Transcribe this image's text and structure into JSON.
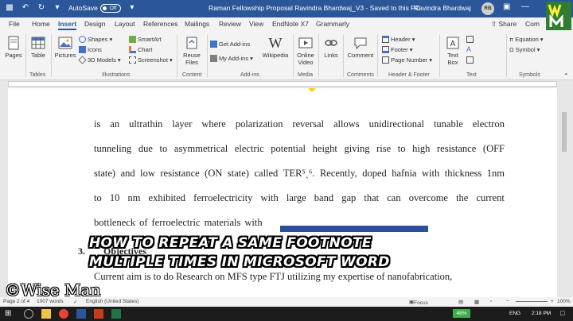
{
  "titlebar": {
    "autosave_label": "AutoSave",
    "autosave_state": "Off",
    "document_title": "Raman Fellowship Proposal Ravindra Bhardwaj_V3  -  Saved to this PC",
    "user_name": "Ravindra Bhardwaj",
    "user_initials": "RB"
  },
  "tabs": [
    "File",
    "Home",
    "Insert",
    "Design",
    "Layout",
    "References",
    "Mailings",
    "Review",
    "View",
    "EndNote X7",
    "Grammarly"
  ],
  "active_tab": "Insert",
  "share_label": "Share",
  "comments_label": "Com",
  "ribbon": {
    "pages": "Pages",
    "table": "Table",
    "pictures": "Pictures",
    "shapes": "Shapes",
    "icons": "Icons",
    "models": "3D Models",
    "smartart": "SmartArt",
    "chart": "Chart",
    "screenshot": "Screenshot",
    "reuse_files": "Reuse Files",
    "get_addins": "Get Add-ins",
    "my_addins": "My Add-ins",
    "wikipedia": "Wikipedia",
    "online_video": "Online Video",
    "links": "Links",
    "comment": "Comment",
    "header": "Header",
    "footer": "Footer",
    "page_number": "Page Number",
    "text_box": "Text Box",
    "equation": "Equation",
    "symbol": "Symbol",
    "groups": {
      "tables": "Tables",
      "illustrations": "Illustrations",
      "content": "Content",
      "addins": "Add-ins",
      "media": "Media",
      "comments": "Comments",
      "header_footer": "Header & Footer",
      "text": "Text",
      "symbols": "Symbols"
    }
  },
  "document": {
    "lines": [
      [
        "is",
        "an",
        "ultrathin",
        "layer",
        "where",
        "polarization",
        "reversal",
        "allows",
        "unidirectional",
        "tunable",
        "electron"
      ],
      [
        "tunneling",
        "due",
        "to",
        "asymmetrical",
        "electric",
        "potential",
        "height",
        "giving",
        "rise",
        "to",
        "high",
        "resistance",
        "(OFF"
      ],
      [
        "state)",
        "and",
        "low",
        "resistance",
        "(ON",
        "state)",
        "called",
        "TER⁵ˎ⁶.",
        "",
        "Recently,",
        "doped",
        "hafnia",
        "with",
        "thickness",
        "1nm"
      ],
      [
        "to",
        "10",
        "nm",
        "exhibited",
        "ferroelectricity",
        "with",
        "large",
        "band",
        "gap",
        "that",
        "can",
        "overcome",
        "the",
        "current"
      ],
      [
        "bottleneck",
        "of",
        "ferroelectric",
        "materials",
        "with"
      ]
    ],
    "section_number": "3.",
    "section_title": "Objectives",
    "partial_line": "Current aim is to do Research on MFS type FTJ utilizing my expertise of nanofabrication,"
  },
  "overlay": {
    "line1": "HOW TO REPEAT A SAME FOOTNOTE",
    "line2": "MULTIPLE TIMES IN MICROSOFT WORD",
    "watermark": "©Wise Man"
  },
  "statusbar": {
    "page": "Page 2 of 4",
    "words": "1007 words",
    "language": "English (United States)",
    "focus": "Focus",
    "zoom": "100%"
  },
  "taskbar": {
    "battery": "48%",
    "language": "ENG",
    "time": "2:18 PM"
  }
}
